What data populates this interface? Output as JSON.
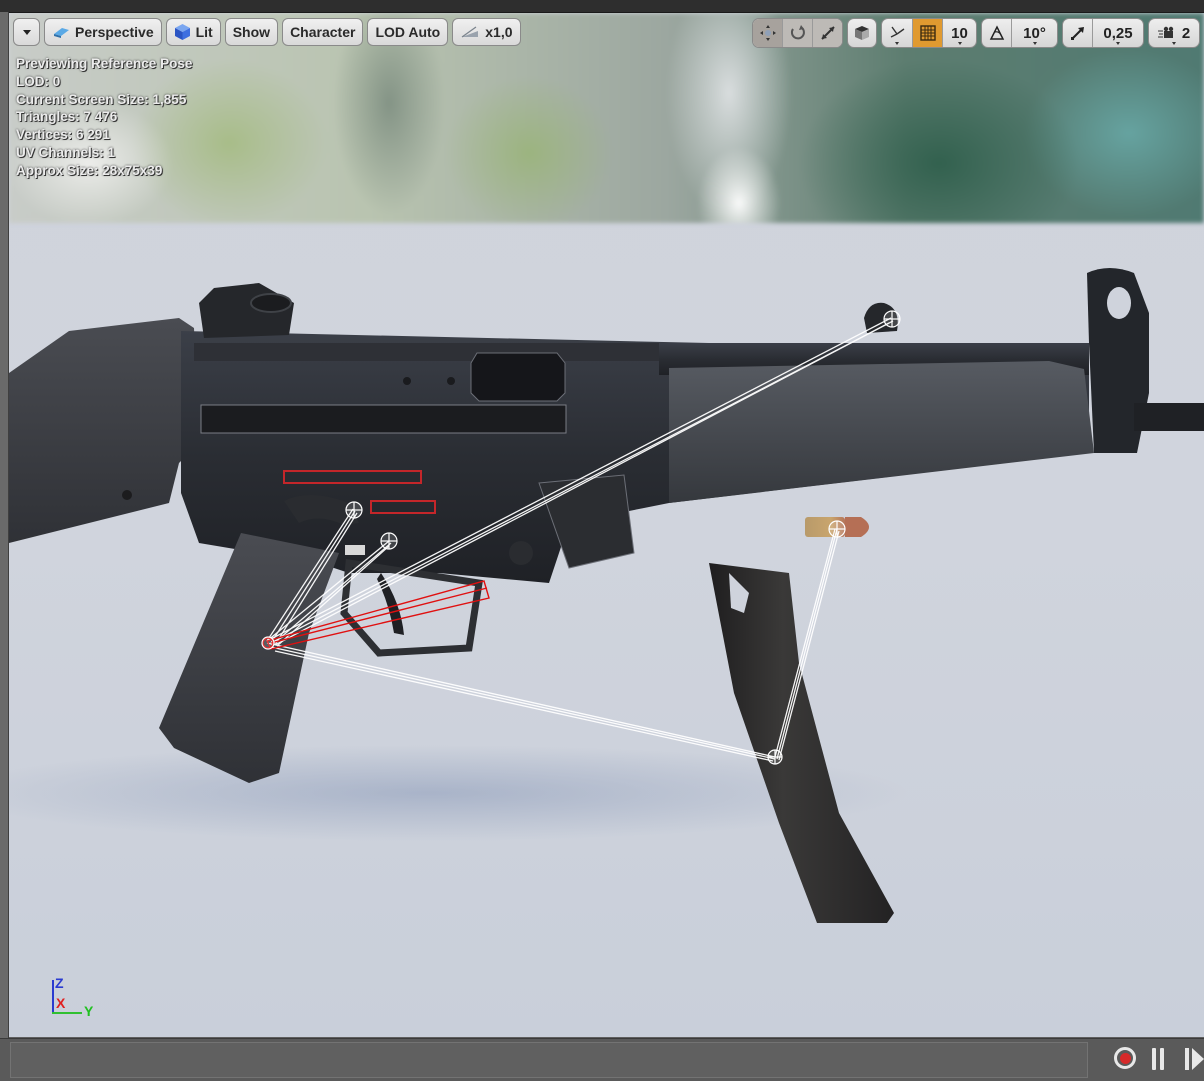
{
  "toolbar_left": {
    "menu_button": "",
    "view_mode": "Perspective",
    "lighting": "Lit",
    "show": "Show",
    "character": "Character",
    "lod": "LOD Auto",
    "playback_speed": "x1,0"
  },
  "toolbar_right": {
    "transform_modes": [
      "translate",
      "rotate",
      "scale"
    ],
    "active_transform": "translate",
    "grid_snap_value": "10",
    "grid_snap_enabled": true,
    "rotation_snap_value": "10°",
    "scale_snap_value": "0,25",
    "camera_speed": "2",
    "accent_color": "#e09a30"
  },
  "stats": {
    "line1": "Previewing Reference Pose",
    "line2": "LOD: 0",
    "line3": "Current Screen Size: 1,855",
    "line4": "Triangles: 7 476",
    "line5": "Vertices: 6 291",
    "line6": "UV Channels: 1",
    "line7": "Approx Size: 28x75x39"
  },
  "axis_gizmo": {
    "z": "Z",
    "x": "X",
    "y": "Y"
  },
  "scene": {
    "subject": "submachine gun skeletal mesh with detached magazine and cartridge",
    "bone_line_color": "#ffffff",
    "selected_bone_color": "#e01010"
  },
  "playback": {
    "record_label": "record",
    "pause_label": "pause",
    "step_label": "step-forward"
  }
}
